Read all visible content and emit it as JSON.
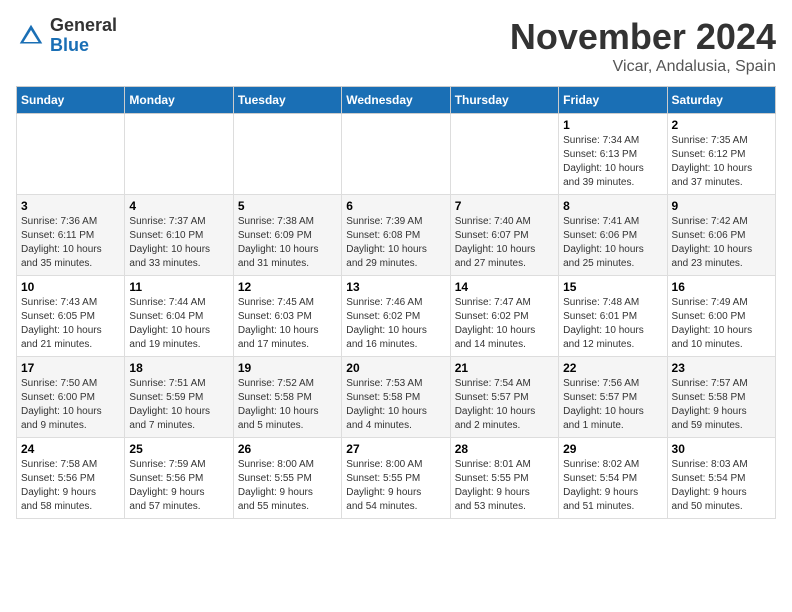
{
  "header": {
    "logo_general": "General",
    "logo_blue": "Blue",
    "month_title": "November 2024",
    "location": "Vicar, Andalusia, Spain"
  },
  "weekdays": [
    "Sunday",
    "Monday",
    "Tuesday",
    "Wednesday",
    "Thursday",
    "Friday",
    "Saturday"
  ],
  "weeks": [
    [
      {
        "day": "",
        "info": ""
      },
      {
        "day": "",
        "info": ""
      },
      {
        "day": "",
        "info": ""
      },
      {
        "day": "",
        "info": ""
      },
      {
        "day": "",
        "info": ""
      },
      {
        "day": "1",
        "info": "Sunrise: 7:34 AM\nSunset: 6:13 PM\nDaylight: 10 hours\nand 39 minutes."
      },
      {
        "day": "2",
        "info": "Sunrise: 7:35 AM\nSunset: 6:12 PM\nDaylight: 10 hours\nand 37 minutes."
      }
    ],
    [
      {
        "day": "3",
        "info": "Sunrise: 7:36 AM\nSunset: 6:11 PM\nDaylight: 10 hours\nand 35 minutes."
      },
      {
        "day": "4",
        "info": "Sunrise: 7:37 AM\nSunset: 6:10 PM\nDaylight: 10 hours\nand 33 minutes."
      },
      {
        "day": "5",
        "info": "Sunrise: 7:38 AM\nSunset: 6:09 PM\nDaylight: 10 hours\nand 31 minutes."
      },
      {
        "day": "6",
        "info": "Sunrise: 7:39 AM\nSunset: 6:08 PM\nDaylight: 10 hours\nand 29 minutes."
      },
      {
        "day": "7",
        "info": "Sunrise: 7:40 AM\nSunset: 6:07 PM\nDaylight: 10 hours\nand 27 minutes."
      },
      {
        "day": "8",
        "info": "Sunrise: 7:41 AM\nSunset: 6:06 PM\nDaylight: 10 hours\nand 25 minutes."
      },
      {
        "day": "9",
        "info": "Sunrise: 7:42 AM\nSunset: 6:06 PM\nDaylight: 10 hours\nand 23 minutes."
      }
    ],
    [
      {
        "day": "10",
        "info": "Sunrise: 7:43 AM\nSunset: 6:05 PM\nDaylight: 10 hours\nand 21 minutes."
      },
      {
        "day": "11",
        "info": "Sunrise: 7:44 AM\nSunset: 6:04 PM\nDaylight: 10 hours\nand 19 minutes."
      },
      {
        "day": "12",
        "info": "Sunrise: 7:45 AM\nSunset: 6:03 PM\nDaylight: 10 hours\nand 17 minutes."
      },
      {
        "day": "13",
        "info": "Sunrise: 7:46 AM\nSunset: 6:02 PM\nDaylight: 10 hours\nand 16 minutes."
      },
      {
        "day": "14",
        "info": "Sunrise: 7:47 AM\nSunset: 6:02 PM\nDaylight: 10 hours\nand 14 minutes."
      },
      {
        "day": "15",
        "info": "Sunrise: 7:48 AM\nSunset: 6:01 PM\nDaylight: 10 hours\nand 12 minutes."
      },
      {
        "day": "16",
        "info": "Sunrise: 7:49 AM\nSunset: 6:00 PM\nDaylight: 10 hours\nand 10 minutes."
      }
    ],
    [
      {
        "day": "17",
        "info": "Sunrise: 7:50 AM\nSunset: 6:00 PM\nDaylight: 10 hours\nand 9 minutes."
      },
      {
        "day": "18",
        "info": "Sunrise: 7:51 AM\nSunset: 5:59 PM\nDaylight: 10 hours\nand 7 minutes."
      },
      {
        "day": "19",
        "info": "Sunrise: 7:52 AM\nSunset: 5:58 PM\nDaylight: 10 hours\nand 5 minutes."
      },
      {
        "day": "20",
        "info": "Sunrise: 7:53 AM\nSunset: 5:58 PM\nDaylight: 10 hours\nand 4 minutes."
      },
      {
        "day": "21",
        "info": "Sunrise: 7:54 AM\nSunset: 5:57 PM\nDaylight: 10 hours\nand 2 minutes."
      },
      {
        "day": "22",
        "info": "Sunrise: 7:56 AM\nSunset: 5:57 PM\nDaylight: 10 hours\nand 1 minute."
      },
      {
        "day": "23",
        "info": "Sunrise: 7:57 AM\nSunset: 5:58 PM\nDaylight: 9 hours\nand 59 minutes."
      }
    ],
    [
      {
        "day": "24",
        "info": "Sunrise: 7:58 AM\nSunset: 5:56 PM\nDaylight: 9 hours\nand 58 minutes."
      },
      {
        "day": "25",
        "info": "Sunrise: 7:59 AM\nSunset: 5:56 PM\nDaylight: 9 hours\nand 57 minutes."
      },
      {
        "day": "26",
        "info": "Sunrise: 8:00 AM\nSunset: 5:55 PM\nDaylight: 9 hours\nand 55 minutes."
      },
      {
        "day": "27",
        "info": "Sunrise: 8:00 AM\nSunset: 5:55 PM\nDaylight: 9 hours\nand 54 minutes."
      },
      {
        "day": "28",
        "info": "Sunrise: 8:01 AM\nSunset: 5:55 PM\nDaylight: 9 hours\nand 53 minutes."
      },
      {
        "day": "29",
        "info": "Sunrise: 8:02 AM\nSunset: 5:54 PM\nDaylight: 9 hours\nand 51 minutes."
      },
      {
        "day": "30",
        "info": "Sunrise: 8:03 AM\nSunset: 5:54 PM\nDaylight: 9 hours\nand 50 minutes."
      }
    ]
  ]
}
